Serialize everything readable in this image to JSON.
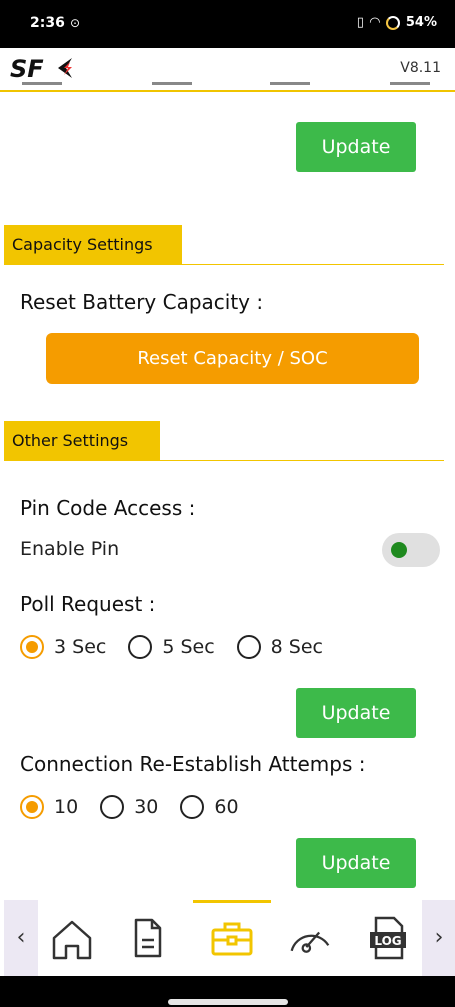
{
  "status_bar": {
    "time": "2:36",
    "battery": "54%"
  },
  "header": {
    "version": "V8.11",
    "logo_text": "SFK"
  },
  "slider_update_label": "Update",
  "capacity_section": {
    "title": "Capacity Settings",
    "reset_label": "Reset Battery Capacity :",
    "reset_button": "Reset Capacity / SOC"
  },
  "other_section": {
    "title": "Other Settings",
    "pin_label": "Pin Code Access :",
    "enable_pin_label": "Enable Pin",
    "enable_pin_on": true,
    "poll_label": "Poll Request :",
    "poll_options": [
      "3 Sec",
      "5 Sec",
      "8 Sec"
    ],
    "poll_selected": "3 Sec",
    "poll_update": "Update",
    "reconnect_label": "Connection Re-Establish Attemps :",
    "reconnect_options": [
      "10",
      "30",
      "60"
    ],
    "reconnect_selected": "10",
    "reconnect_update": "Update"
  },
  "bottom_nav": {
    "items": [
      "home-icon",
      "document-icon",
      "toolbox-icon",
      "gauge-icon",
      "log-icon"
    ],
    "active": "toolbox-icon",
    "log_text": "LOG"
  },
  "colors": {
    "accent_yellow": "#f2c500",
    "green": "#3dba4a",
    "orange": "#f59c00"
  }
}
